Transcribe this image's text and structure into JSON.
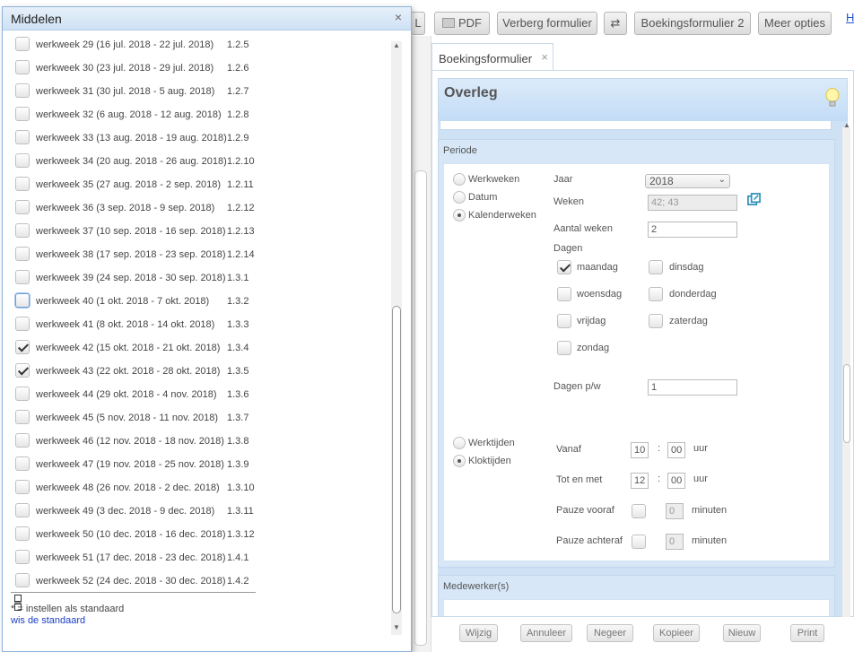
{
  "toolbar": {
    "partial_left": "L",
    "pdf": "PDF",
    "hide_forms": "Verberg formulier",
    "swap_glyph": "⇄",
    "booking_form_2": "Boekingsformulier 2",
    "more_options": "Meer opties",
    "edge_link": "H"
  },
  "tab": {
    "label": "Boekingsformulier",
    "close": "×"
  },
  "form": {
    "title": "Overleg",
    "periode": {
      "title": "Periode",
      "mode_werkweken": "Werkweken",
      "mode_datum": "Datum",
      "mode_kalenderweken": "Kalenderweken",
      "jaar_label": "Jaar",
      "jaar_value": "2018",
      "weken_label": "Weken",
      "weken_value": "42; 43",
      "aantal_weken_label": "Aantal weken",
      "aantal_weken_value": "2",
      "dagen_label": "Dagen",
      "days": {
        "maandag": "maandag",
        "dinsdag": "dinsdag",
        "woensdag": "woensdag",
        "donderdag": "donderdag",
        "vrijdag": "vrijdag",
        "zaterdag": "zaterdag",
        "zondag": "zondag"
      },
      "dagen_pw_label": "Dagen p/w",
      "dagen_pw_value": "1",
      "werktijden": "Werktijden",
      "kloktijden": "Kloktijden",
      "vanaf_label": "Vanaf",
      "vanaf_h": "10",
      "vanaf_m": "00",
      "tot_label": "Tot en met",
      "tot_h": "12",
      "tot_m": "00",
      "colon": ":",
      "uur": "uur",
      "pauze_vooraf_label": "Pauze vooraf",
      "pauze_vooraf_value": "0",
      "pauze_achteraf_label": "Pauze achteraf",
      "pauze_achteraf_value": "0",
      "minuten": "minuten"
    },
    "medewerkers": {
      "title": "Medewerker(s)"
    }
  },
  "bottom": {
    "wijzig": "Wijzig",
    "annuleer": "Annuleer",
    "negeer": "Negeer",
    "kopieer": "Kopieer",
    "nieuw": "Nieuw",
    "print": "Print"
  },
  "dialog": {
    "title": "Middelen",
    "close": "×",
    "weeks": [
      {
        "label": "werkweek 29 (16 jul. 2018 - 22 jul. 2018)",
        "code": "1.2.5",
        "checked": false
      },
      {
        "label": "werkweek 30 (23 jul. 2018 - 29 jul. 2018)",
        "code": "1.2.6",
        "checked": false
      },
      {
        "label": "werkweek 31 (30 jul. 2018 - 5 aug. 2018)",
        "code": "1.2.7",
        "checked": false
      },
      {
        "label": "werkweek 32 (6 aug. 2018 - 12 aug. 2018)",
        "code": "1.2.8",
        "checked": false
      },
      {
        "label": "werkweek 33 (13 aug. 2018 - 19 aug. 2018)",
        "code": "1.2.9",
        "checked": false
      },
      {
        "label": "werkweek 34 (20 aug. 2018 - 26 aug. 2018)",
        "code": "1.2.10",
        "checked": false
      },
      {
        "label": "werkweek 35 (27 aug. 2018 - 2 sep. 2018)",
        "code": "1.2.11",
        "checked": false
      },
      {
        "label": "werkweek 36 (3 sep. 2018 - 9 sep. 2018)",
        "code": "1.2.12",
        "checked": false
      },
      {
        "label": "werkweek 37 (10 sep. 2018 - 16 sep. 2018)",
        "code": "1.2.13",
        "checked": false
      },
      {
        "label": "werkweek 38 (17 sep. 2018 - 23 sep. 2018)",
        "code": "1.2.14",
        "checked": false
      },
      {
        "label": "werkweek 39 (24 sep. 2018 - 30 sep. 2018)",
        "code": "1.3.1",
        "checked": false
      },
      {
        "label": "werkweek 40 (1 okt. 2018 - 7 okt. 2018)",
        "code": "1.3.2",
        "checked": false,
        "focused": true
      },
      {
        "label": "werkweek 41 (8 okt. 2018 - 14 okt. 2018)",
        "code": "1.3.3",
        "checked": false
      },
      {
        "label": "werkweek 42 (15 okt. 2018 - 21 okt. 2018)",
        "code": "1.3.4",
        "checked": true
      },
      {
        "label": "werkweek 43 (22 okt. 2018 - 28 okt. 2018)",
        "code": "1.3.5",
        "checked": true
      },
      {
        "label": "werkweek 44 (29 okt. 2018 - 4 nov. 2018)",
        "code": "1.3.6",
        "checked": false
      },
      {
        "label": "werkweek 45 (5 nov. 2018 - 11 nov. 2018)",
        "code": "1.3.7",
        "checked": false
      },
      {
        "label": "werkweek 46 (12 nov. 2018 - 18 nov. 2018)",
        "code": "1.3.8",
        "checked": false
      },
      {
        "label": "werkweek 47 (19 nov. 2018 - 25 nov. 2018)",
        "code": "1.3.9",
        "checked": false
      },
      {
        "label": "werkweek 48 (26 nov. 2018 - 2 dec. 2018)",
        "code": "1.3.10",
        "checked": false
      },
      {
        "label": "werkweek 49 (3 dec. 2018 - 9 dec. 2018)",
        "code": "1.3.11",
        "checked": false
      },
      {
        "label": "werkweek 50 (10 dec. 2018 - 16 dec. 2018)",
        "code": "1.3.12",
        "checked": false
      },
      {
        "label": "werkweek 51 (17 dec. 2018 - 23 dec. 2018)",
        "code": "1.4.1",
        "checked": false
      },
      {
        "label": "werkweek 52 (24 dec. 2018 - 30 dec. 2018)",
        "code": "1.4.2",
        "checked": false
      }
    ],
    "legend_text": "* = instellen als standaard",
    "clear_default": "wis de standaard"
  }
}
